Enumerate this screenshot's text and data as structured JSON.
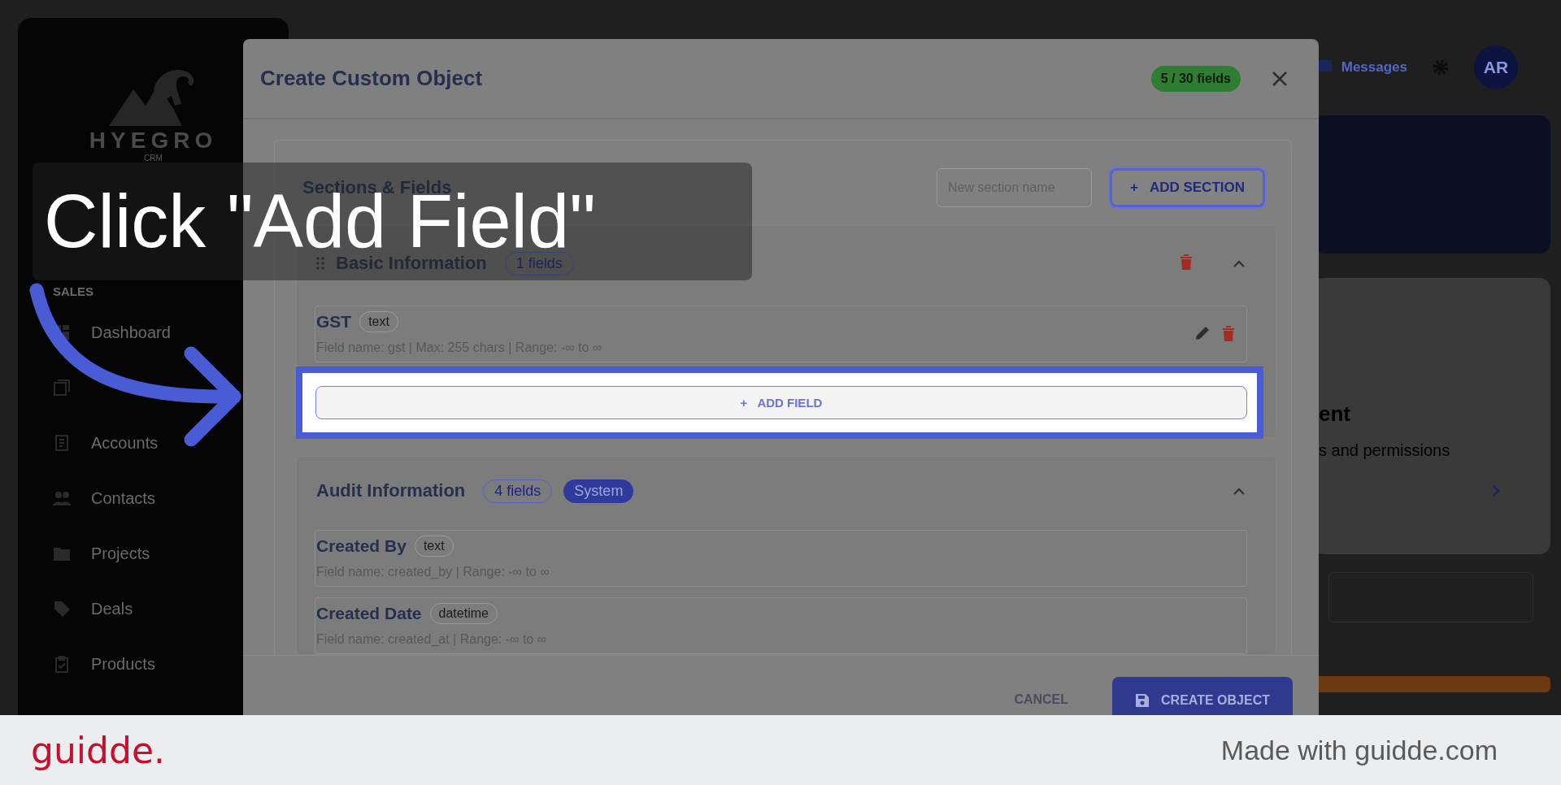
{
  "sidebar": {
    "logo": {
      "name": "HYEGRO",
      "tagline": "CRM"
    },
    "group_label": "SALES",
    "items": [
      {
        "kind": "labeled",
        "label": "Dashboard"
      },
      {
        "kind": "icon_only"
      },
      {
        "kind": "labeled",
        "label": "Accounts"
      },
      {
        "kind": "labeled",
        "label": "Contacts"
      },
      {
        "kind": "labeled",
        "label": "Projects"
      },
      {
        "kind": "labeled",
        "label": "Deals"
      },
      {
        "kind": "labeled",
        "label": "Products"
      }
    ]
  },
  "header": {
    "messages": "Messages",
    "avatar": "AR"
  },
  "background_card": {
    "heading": "ent",
    "text": "s and permissions"
  },
  "modal": {
    "title": "Create Custom Object",
    "field_count": "5 / 30 fields",
    "panel_title": "Sections & Fields",
    "section_name_placeholder": "New section name",
    "add_section": "ADD SECTION",
    "add_section_icon": "+",
    "sections": [
      {
        "title": "Basic Information",
        "count": "1 fields",
        "system": false,
        "draggable": true,
        "deletable": true,
        "add_field": "ADD FIELD",
        "add_field_icon": "+",
        "fields": [
          {
            "label": "GST",
            "type": "text",
            "details": "Field name: gst | Max: 255 chars | Range: -∞ to ∞",
            "editable": true
          }
        ]
      },
      {
        "title": "Audit Information",
        "count": "4 fields",
        "system": true,
        "system_label": "System",
        "draggable": false,
        "deletable": false,
        "fields": [
          {
            "label": "Created By",
            "type": "text",
            "details": "Field name: created_by | Range: -∞ to ∞",
            "editable": false
          },
          {
            "label": "Created Date",
            "type": "datetime",
            "details": "Field name: created_at | Range: -∞ to ∞",
            "editable": false
          }
        ]
      }
    ],
    "cancel": "CANCEL",
    "create": "CREATE OBJECT"
  },
  "callout": {
    "text": "Click \"Add Field\""
  },
  "footer": {
    "logo": "guidde.",
    "note": "Made with guidde.com"
  }
}
